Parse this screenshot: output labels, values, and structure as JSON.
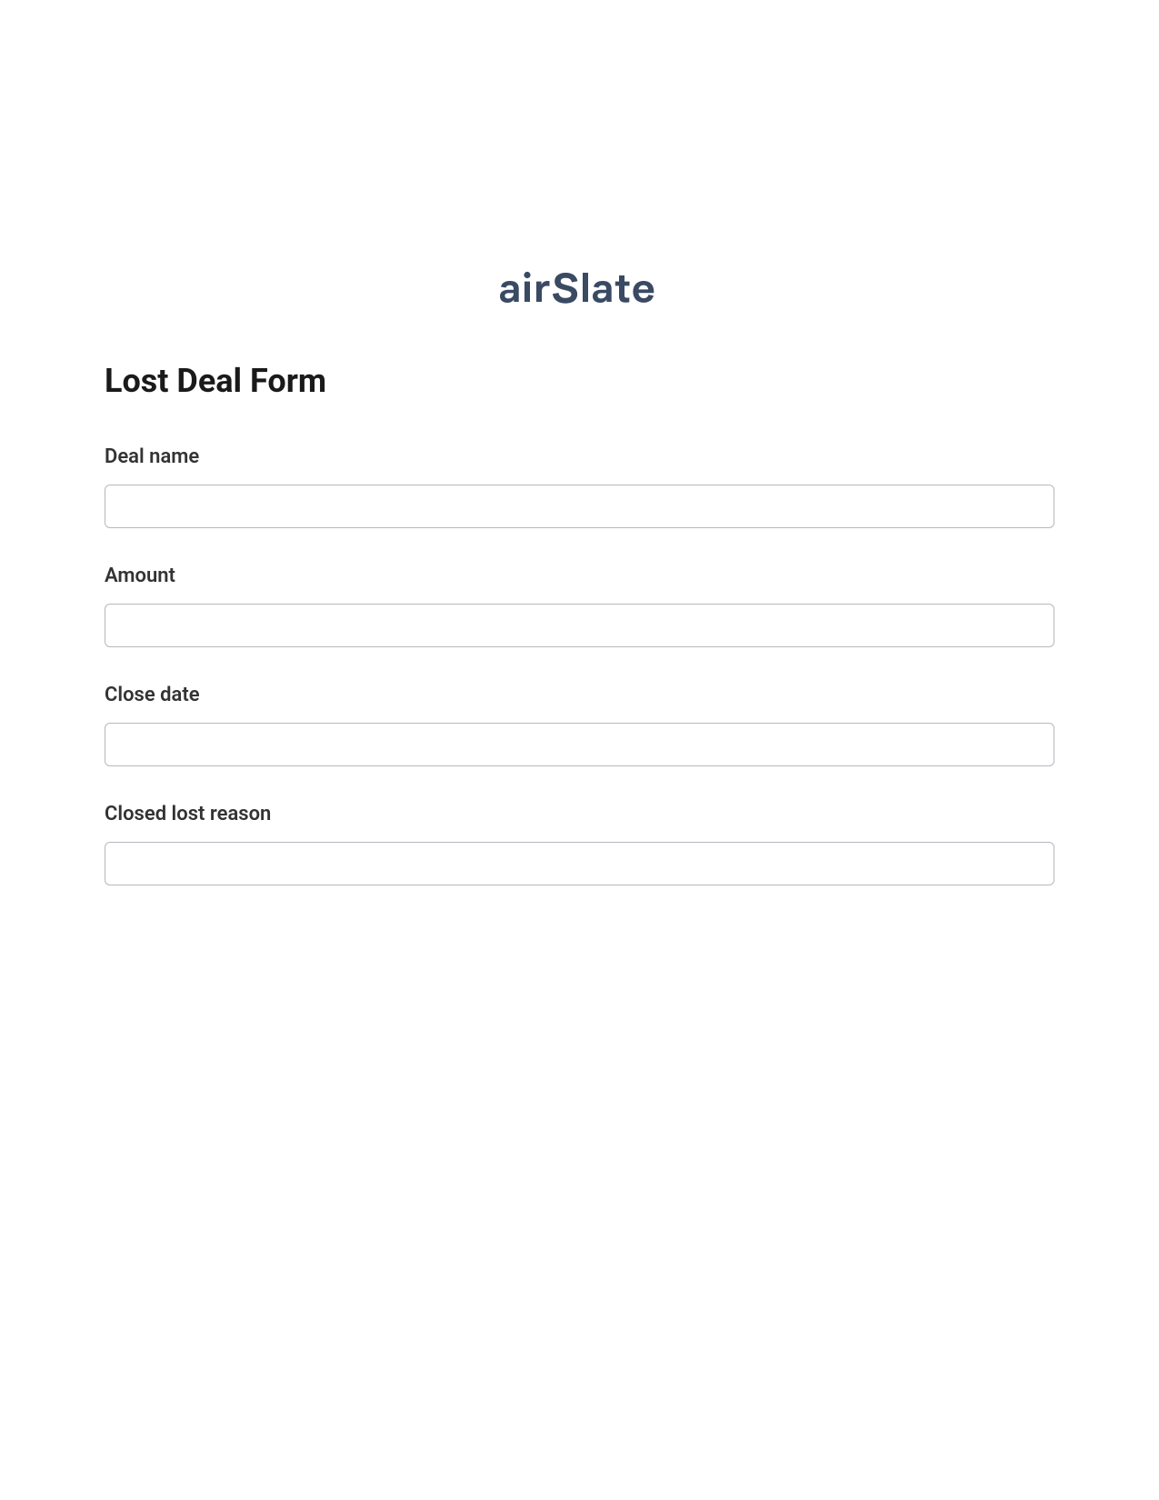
{
  "logo": {
    "text": "airSlate",
    "color": "#3a4a63"
  },
  "form": {
    "title": "Lost Deal Form",
    "fields": [
      {
        "label": "Deal name",
        "value": ""
      },
      {
        "label": "Amount",
        "value": ""
      },
      {
        "label": "Close date",
        "value": ""
      },
      {
        "label": "Closed lost reason",
        "value": ""
      }
    ]
  }
}
